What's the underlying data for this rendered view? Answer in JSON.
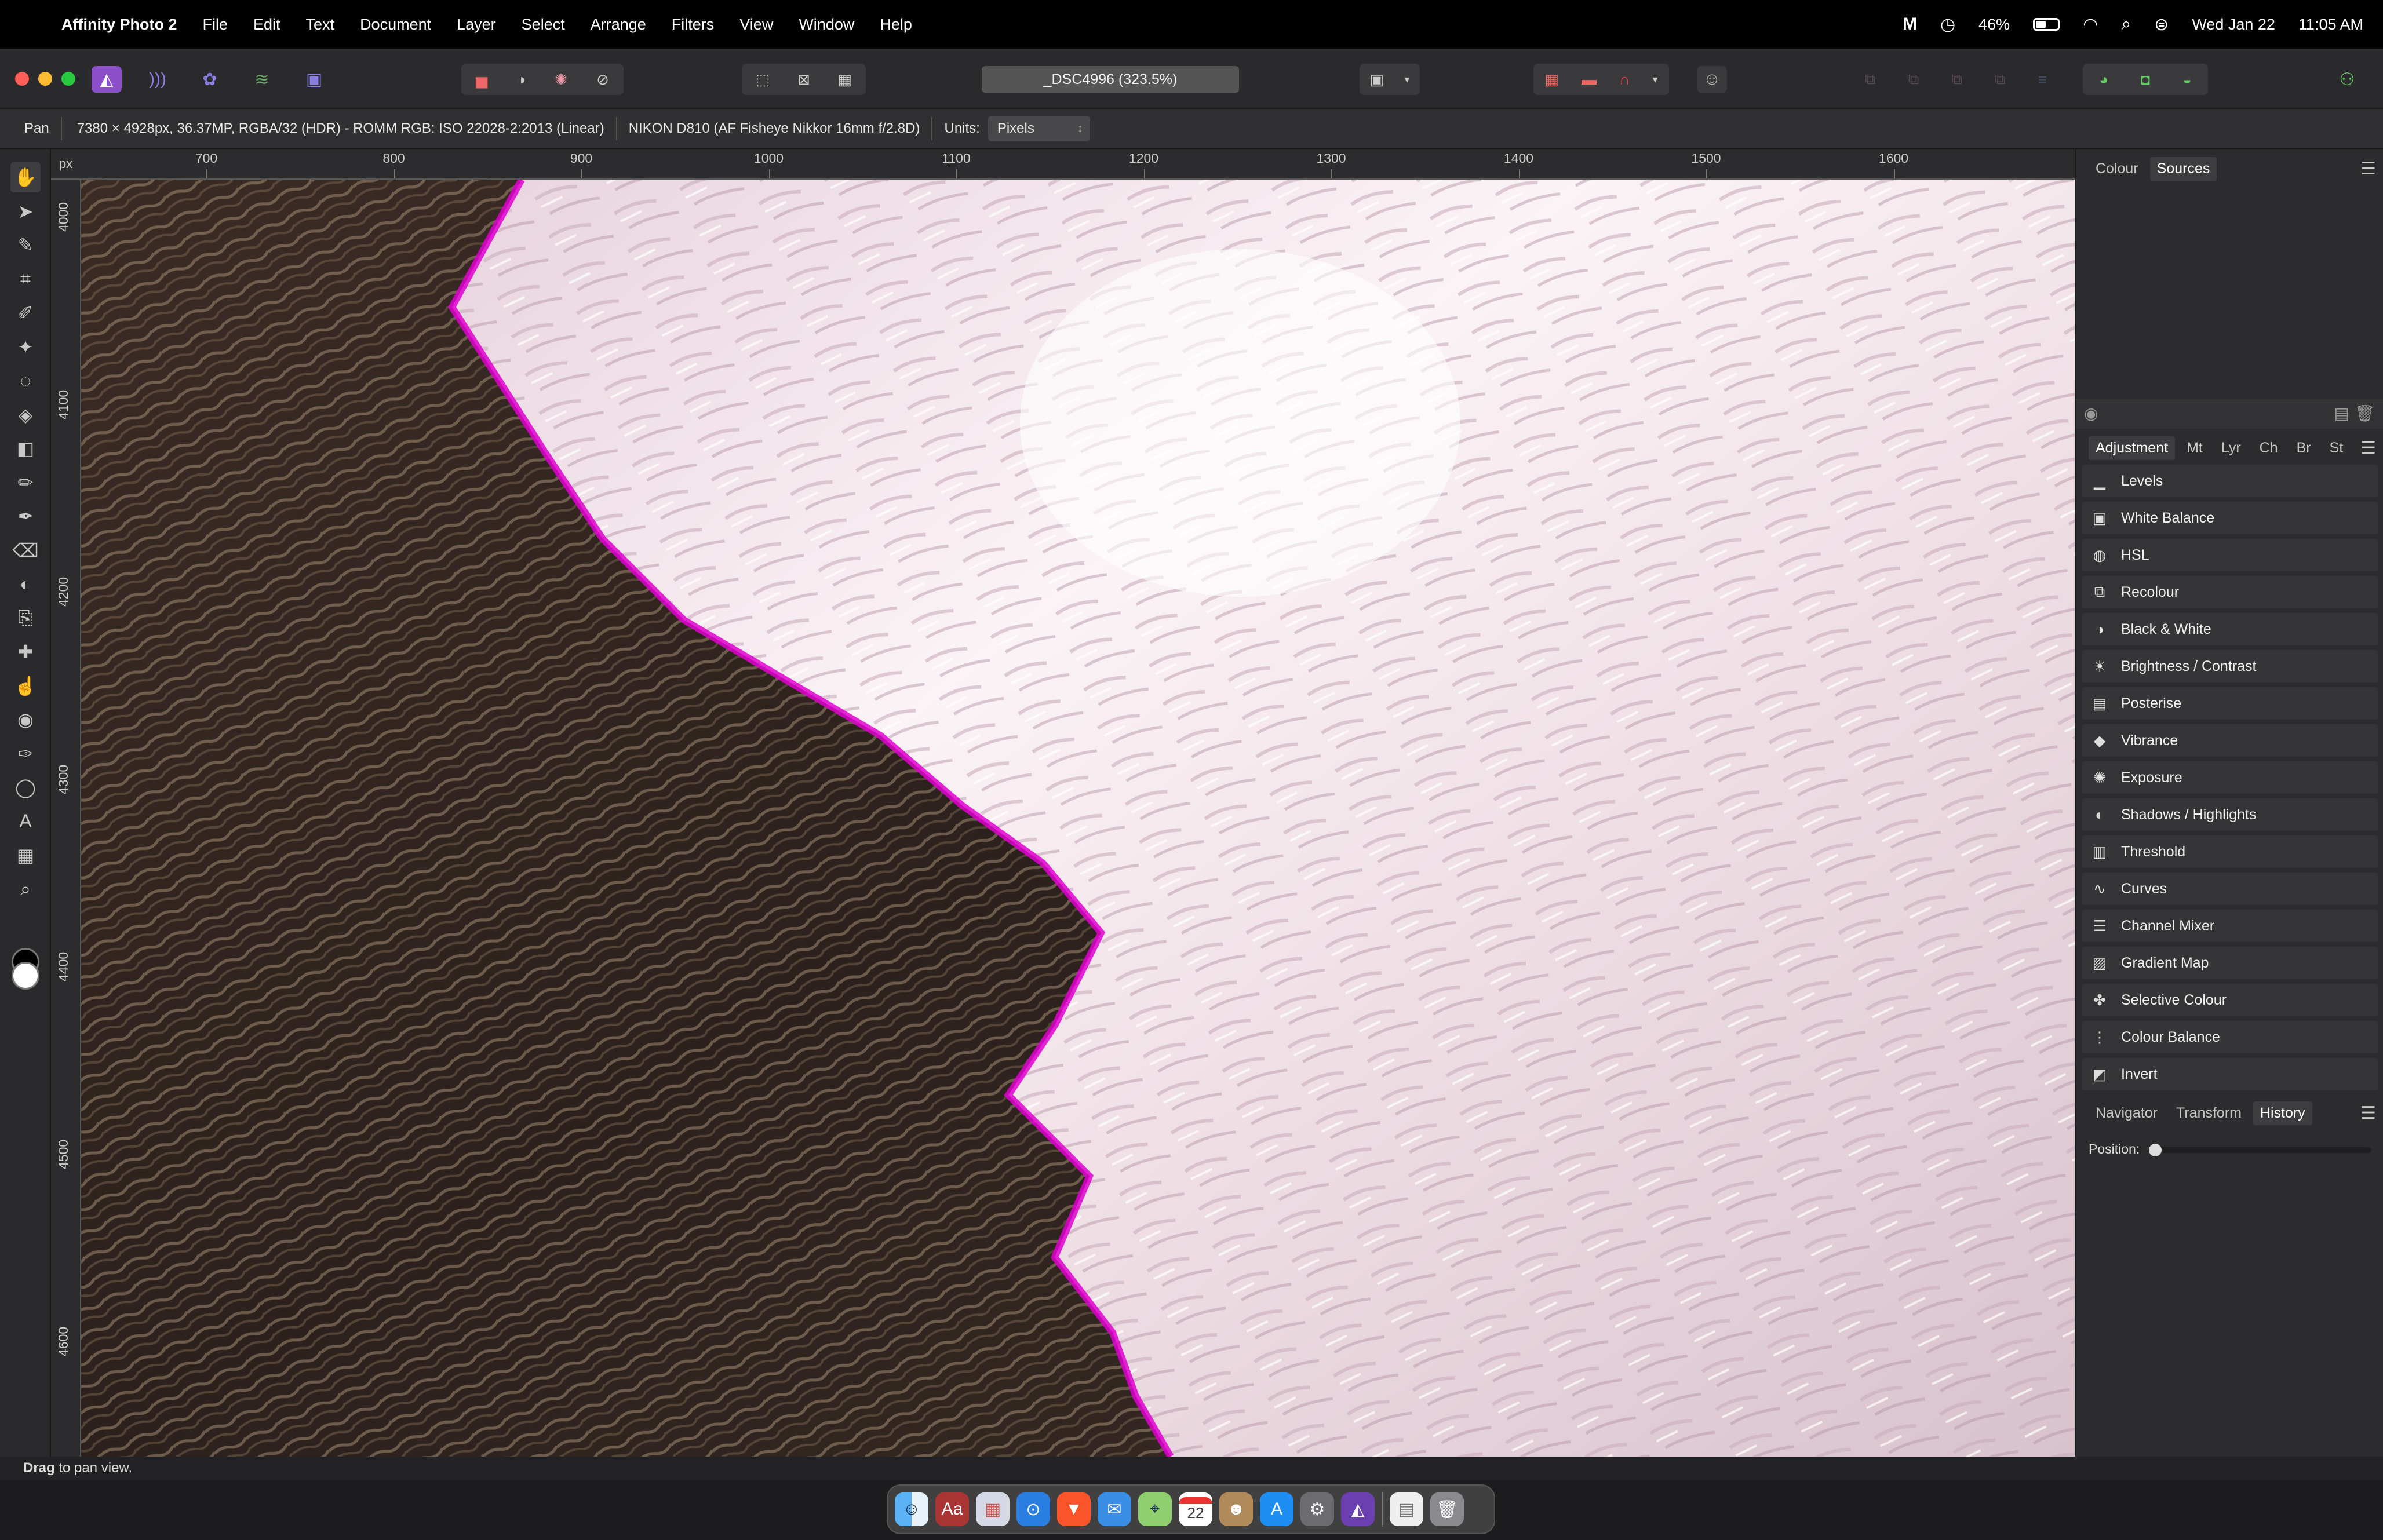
{
  "menubar": {
    "app_name": "Affinity Photo 2",
    "items": [
      "File",
      "Edit",
      "Text",
      "Document",
      "Layer",
      "Select",
      "Arrange",
      "Filters",
      "View",
      "Window",
      "Help"
    ],
    "battery": "46%",
    "battery_level": 0.46,
    "date": "Wed Jan 22",
    "time": "11:05 AM"
  },
  "toolbar": {
    "document_title": "_DSC4996 (323.5%)"
  },
  "context": {
    "tool_name": "Pan",
    "image_info": "7380 × 4928px, 36.37MP, RGBA/32 (HDR) - ROMM RGB: ISO 22028-2:2013 (Linear)",
    "camera_info": "NIKON D810 (AF Fisheye Nikkor 16mm f/2.8D)",
    "units_label": "Units:",
    "units_value": "Pixels"
  },
  "ruler": {
    "unit": "px",
    "x_labels": [
      "700",
      "800",
      "900",
      "1000",
      "1100",
      "1200",
      "1300",
      "1400",
      "1500",
      "1600"
    ],
    "y_labels": [
      "4000",
      "4100",
      "4200",
      "4300",
      "4400",
      "4500",
      "4600"
    ]
  },
  "tools": [
    {
      "name": "view-tool",
      "glyph": "✋"
    },
    {
      "name": "move-tool",
      "glyph": "➤"
    },
    {
      "name": "color-picker-tool",
      "glyph": "✎"
    },
    {
      "name": "crop-tool",
      "glyph": "⌗"
    },
    {
      "name": "selection-brush-tool",
      "glyph": "✐"
    },
    {
      "name": "flood-select-tool",
      "glyph": "✦"
    },
    {
      "name": "freehand-selection-tool",
      "glyph": "◌"
    },
    {
      "name": "flood-fill-tool",
      "glyph": "◈"
    },
    {
      "name": "gradient-tool",
      "glyph": "◧"
    },
    {
      "name": "paint-brush-tool",
      "glyph": "✏"
    },
    {
      "name": "paint-mixer-brush-tool",
      "glyph": "✒"
    },
    {
      "name": "erase-brush-tool",
      "glyph": "⌫"
    },
    {
      "name": "dodge-brush-tool",
      "glyph": "◐"
    },
    {
      "name": "clone-brush-tool",
      "glyph": "⎘"
    },
    {
      "name": "blemish-removal-tool",
      "glyph": "✚"
    },
    {
      "name": "smudge-brush-tool",
      "glyph": "☝"
    },
    {
      "name": "red-eye-tool",
      "glyph": "◉"
    },
    {
      "name": "pen-tool",
      "glyph": "✑"
    },
    {
      "name": "ellipse-tool",
      "glyph": "◯"
    },
    {
      "name": "artistic-text-tool",
      "glyph": "A"
    },
    {
      "name": "mesh-warp-tool",
      "glyph": "▦"
    },
    {
      "name": "zoom-tool",
      "glyph": "⌕"
    }
  ],
  "panel": {
    "top_tabs": [
      "Colour",
      "Sources"
    ],
    "top_active": "Sources",
    "adj_tabs": [
      "Adjustment",
      "Mt",
      "Lyr",
      "Ch",
      "Br",
      "St"
    ],
    "adj_active": "Adjustment",
    "adjustments": [
      {
        "label": "Levels",
        "icon": "levels-icon",
        "glyph": "▁"
      },
      {
        "label": "White Balance",
        "icon": "white-balance-icon",
        "glyph": "▣"
      },
      {
        "label": "HSL",
        "icon": "hsl-icon",
        "glyph": "◍"
      },
      {
        "label": "Recolour",
        "icon": "recolour-icon",
        "glyph": "⧉"
      },
      {
        "label": "Black & White",
        "icon": "black-white-icon",
        "glyph": "◑"
      },
      {
        "label": "Brightness / Contrast",
        "icon": "brightness-contrast-icon",
        "glyph": "☀"
      },
      {
        "label": "Posterise",
        "icon": "posterise-icon",
        "glyph": "▤"
      },
      {
        "label": "Vibrance",
        "icon": "vibrance-icon",
        "glyph": "◆"
      },
      {
        "label": "Exposure",
        "icon": "exposure-icon",
        "glyph": "✺"
      },
      {
        "label": "Shadows / Highlights",
        "icon": "shadows-highlights-icon",
        "glyph": "◐"
      },
      {
        "label": "Threshold",
        "icon": "threshold-icon",
        "glyph": "▥"
      },
      {
        "label": "Curves",
        "icon": "curves-icon",
        "glyph": "∿"
      },
      {
        "label": "Channel Mixer",
        "icon": "channel-mixer-icon",
        "glyph": "☰"
      },
      {
        "label": "Gradient Map",
        "icon": "gradient-map-icon",
        "glyph": "▨"
      },
      {
        "label": "Selective Colour",
        "icon": "selective-colour-icon",
        "glyph": "✤"
      },
      {
        "label": "Colour Balance",
        "icon": "colour-balance-icon",
        "glyph": "⋮"
      },
      {
        "label": "Invert",
        "icon": "invert-icon",
        "glyph": "◩"
      }
    ],
    "bottom_tabs": [
      "Navigator",
      "Transform",
      "History"
    ],
    "bottom_active": "History",
    "history_position_label": "Position:",
    "history_position": 0
  },
  "statusbar": {
    "bold": "Drag",
    "text": " to pan view."
  },
  "dock": {
    "calendar_day": "22",
    "apps": [
      "finder-icon",
      "dictionary-icon",
      "launchpad-icon",
      "safari-icon",
      "brave-icon",
      "mail-icon",
      "maps-icon",
      "calendar-icon",
      "contacts-icon",
      "app-store-icon",
      "system-settings-icon",
      "affinity-photo-icon",
      "document-icon",
      "trash-icon"
    ]
  },
  "colors": {
    "accent": "#8a4fc9",
    "menu_bar": "#000000",
    "panel_bg": "#2c2c2e",
    "active_tab": "#3d3d40"
  }
}
